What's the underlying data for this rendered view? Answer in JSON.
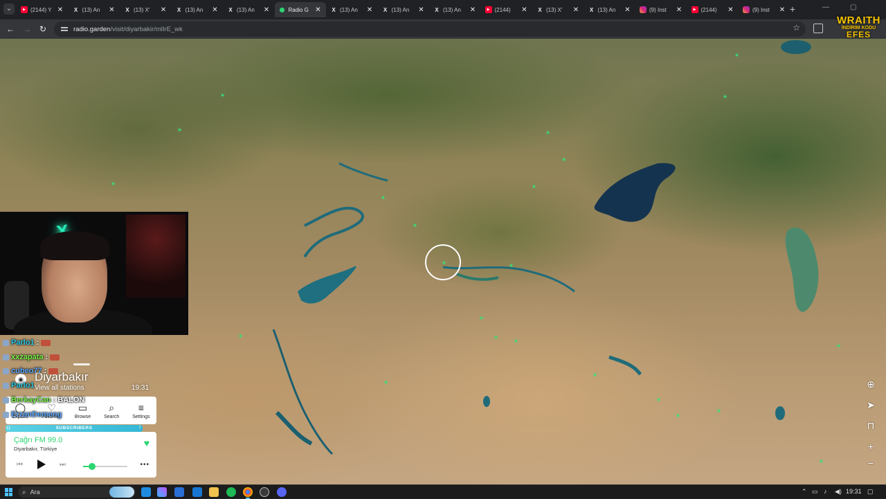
{
  "browser": {
    "tabs": [
      {
        "title": "(2144) Y",
        "favicon": "youtube-icon"
      },
      {
        "title": "(13) An",
        "favicon": "x-icon"
      },
      {
        "title": "(13) X'",
        "favicon": "x-icon"
      },
      {
        "title": "(13) An",
        "favicon": "x-icon"
      },
      {
        "title": "(13) An",
        "favicon": "x-icon"
      },
      {
        "title": "Radio G",
        "favicon": "radio-garden-icon",
        "active": true
      },
      {
        "title": "(13) An",
        "favicon": "x-icon"
      },
      {
        "title": "(13) An",
        "favicon": "x-icon"
      },
      {
        "title": "(13) An",
        "favicon": "x-icon"
      },
      {
        "title": "(2144) ",
        "favicon": "youtube-icon"
      },
      {
        "title": "(13) X'",
        "favicon": "x-icon"
      },
      {
        "title": "(13) An",
        "favicon": "x-icon"
      },
      {
        "title": "(9) Inst",
        "favicon": "instagram-icon"
      },
      {
        "title": "(2144)",
        "favicon": "youtube-icon"
      },
      {
        "title": "(9) Inst",
        "favicon": "instagram-icon"
      }
    ],
    "close_glyph": "✕",
    "new_tab_glyph": "+",
    "address": {
      "host": "radio.garden",
      "path": "/visit/diyarbakir/mlIrE_wk"
    },
    "overlay_brand": {
      "line1": "WRAITH",
      "line2": "İNDİRİM KODU",
      "line3": "EFES"
    }
  },
  "map": {
    "selected_place": "Diyarbakır",
    "map_controls": [
      "globe-icon",
      "locate-icon",
      "lock-icon",
      "zoom-in-icon",
      "zoom-out-icon"
    ]
  },
  "chat": {
    "messages": [
      {
        "user": "Parlo1",
        "sep": " :",
        "color": "#27c9e8"
      },
      {
        "user": "xxzapata",
        "sep": " :",
        "color": "#7cf24a"
      },
      {
        "user": "cubeo77",
        "sep": " :",
        "color": "#5aa7ff"
      },
      {
        "user": "Parlo1",
        "sep": "",
        "color": "#27c9e8"
      },
      {
        "user": "BerkayCan",
        "sep": " : BALON",
        "color": "#7cf24a"
      },
      {
        "user": "ErzanDemeng",
        "sep": "",
        "color": "#5aa7ff"
      }
    ]
  },
  "radio_garden": {
    "place_title": "Diyarbakır",
    "place_subtitle": "View all stations",
    "local_time": "19:31",
    "nav": [
      {
        "label": "Explore",
        "icon": "globe-icon"
      },
      {
        "label": "Favorites",
        "icon": "heart-icon"
      },
      {
        "label": "Browse",
        "icon": "map-icon"
      },
      {
        "label": "Search",
        "icon": "search-icon"
      },
      {
        "label": "Settings",
        "icon": "menu-icon"
      }
    ],
    "subscribers_label": "SUBSCRIBERS",
    "subscribers_count_left": "11",
    "subscribers_count_right": "7",
    "player": {
      "station": "Çağrı FM 99.0",
      "location": "Diyarbakır, Türkiye",
      "volume": 0.2,
      "favorited": true
    },
    "accent": "#2bd670"
  },
  "taskbar": {
    "search_placeholder": "Ara",
    "clock": "19:31",
    "apps": [
      "edge-icon",
      "copilot-icon",
      "store-icon",
      "mail-icon",
      "explorer-icon",
      "spotify-icon",
      "chrome-icon",
      "obs-icon",
      "discord-icon"
    ]
  }
}
